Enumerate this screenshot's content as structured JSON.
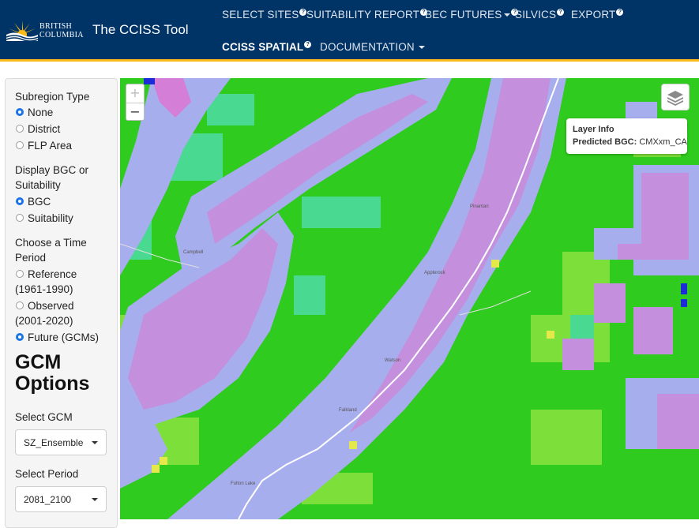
{
  "header": {
    "logo_text_line1": "BRITISH",
    "logo_text_line2": "COLUMBIA",
    "app_title": "The CCISS Tool",
    "nav": [
      {
        "label": "SELECT SITES",
        "badge": "?"
      },
      {
        "label": "SUITABILITY REPORT",
        "badge": "?"
      },
      {
        "label": "BEC FUTURES",
        "badge": "?"
      },
      {
        "label": "SILVICS",
        "badge": "?"
      },
      {
        "label": "EXPORT",
        "badge": "?"
      },
      {
        "label": "CCISS SPATIAL",
        "badge": "?"
      },
      {
        "label": "DOCUMENTATION",
        "badge": ""
      }
    ]
  },
  "sidebar": {
    "subregion": {
      "label": "Subregion Type",
      "options": [
        "None",
        "District",
        "FLP Area"
      ],
      "selected": "None"
    },
    "display": {
      "label_line1": "Display BGC or",
      "label_line2": "Suitability",
      "options": [
        "BGC",
        "Suitability"
      ],
      "selected": "BGC"
    },
    "period": {
      "label_line1": "Choose a Time",
      "label_line2": "Period",
      "options": [
        {
          "line1": "Reference",
          "line2": "(1961-1990)"
        },
        {
          "line1": "Observed",
          "line2": "(2001-2020)"
        },
        {
          "line1": "Future (GCMs)",
          "line2": ""
        }
      ],
      "selected": "Future (GCMs)"
    },
    "gcm_heading_line1": "GCM",
    "gcm_heading_line2": "Options",
    "select_gcm_label": "Select GCM",
    "select_gcm_value": "SZ_Ensemble",
    "select_period_label": "Select Period",
    "select_period_value": "2081_2100"
  },
  "map": {
    "zoom_in": "+",
    "zoom_out": "−",
    "layer_info_title": "Layer Info",
    "layer_info_key": "Predicted BGC:",
    "layer_info_value": "CMXxm_CA",
    "place_labels": [
      "Pinantan",
      "Applerock",
      "Watson",
      "Campbell",
      "Falkland",
      "Fulton Lake"
    ],
    "colors": {
      "green": "#2fcb1e",
      "lavender": "#a7aeee",
      "purple": "#c48fdd",
      "magenta": "#d47ed8",
      "lime": "#7ddf3a",
      "teal": "#49d990",
      "yellow": "#e5e84a",
      "blue": "#1d2ad8"
    }
  }
}
